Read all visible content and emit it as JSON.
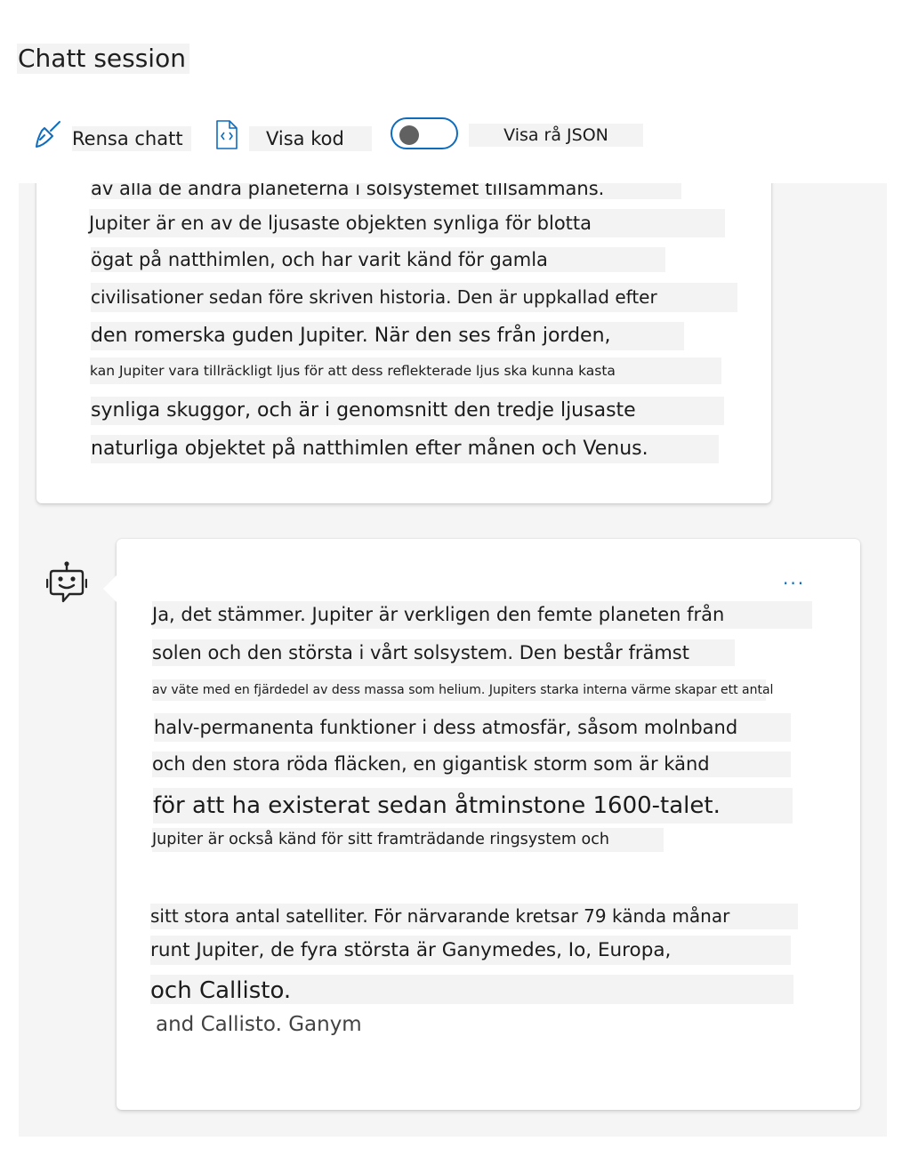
{
  "header": {
    "title": "Chatt session"
  },
  "toolbar": {
    "clear_label": "Rensa chatt",
    "code_label": "Visa kod",
    "json_label": "Visa rå JSON",
    "json_toggle": {
      "on": false
    }
  },
  "colors": {
    "accent": "#0f6cbd",
    "panel": "#f5f5f5",
    "text_highlight": "#f3f3f3"
  },
  "icons": {
    "clear": "broom-icon",
    "code": "code-file-icon",
    "bot": "bot-icon",
    "more": "more-icon"
  },
  "chat": {
    "more_label": "...",
    "user_message": {
      "lines": [
        "av alla de andra planeterna i solsystemet tillsammans.",
        "Jupiter är en av de ljusaste objekten synliga för blotta",
        "ögat på natthimlen, och har varit känd för gamla",
        "civilisationer sedan före skriven historia. Den är uppkallad efter",
        "den romerska guden Jupiter. När den ses från jorden,",
        "kan Jupiter vara tillräckligt ljus för att dess reflekterade ljus ska kunna kasta",
        "synliga skuggor, och är i genomsnitt den tredje ljusaste",
        "naturliga objektet på natthimlen efter månen och Venus."
      ]
    },
    "bot_message": {
      "lines": [
        "Ja, det stämmer. Jupiter är verkligen den femte planeten från",
        "solen och den största i vårt solsystem. Den består främst",
        "av väte med en fjärdedel av dess massa som helium. Jupiters starka interna värme skapar ett antal",
        "halv-permanenta funktioner i dess atmosfär, såsom molnband",
        "och den stora röda fläcken, en gigantisk storm som är känd",
        "för att ha existerat sedan åtminstone 1600-talet.",
        "Jupiter är också känd för sitt framträdande ringsystem och",
        "sitt stora antal satelliter. För närvarande kretsar 79 kända månar",
        "runt Jupiter, de fyra största är Ganymedes, Io, Europa,",
        "och Callisto."
      ],
      "tail": "and Callisto. Ganym"
    }
  }
}
